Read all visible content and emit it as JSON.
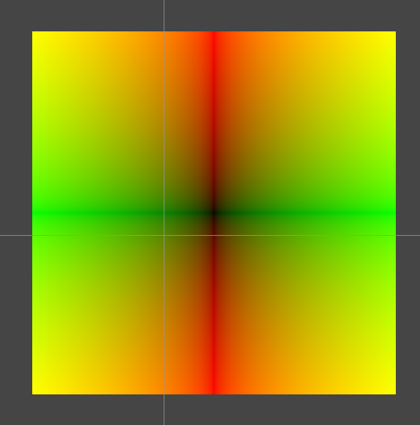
{
  "colors": {
    "background": "#454545",
    "guide_line": "#969696",
    "horizontal_center": "#ff0000",
    "vertical_center": "#00ff00",
    "corners": "#ffff00",
    "center": "#000000"
  },
  "gradient": {
    "horizontal_channel": "red",
    "vertical_channel": "green"
  }
}
